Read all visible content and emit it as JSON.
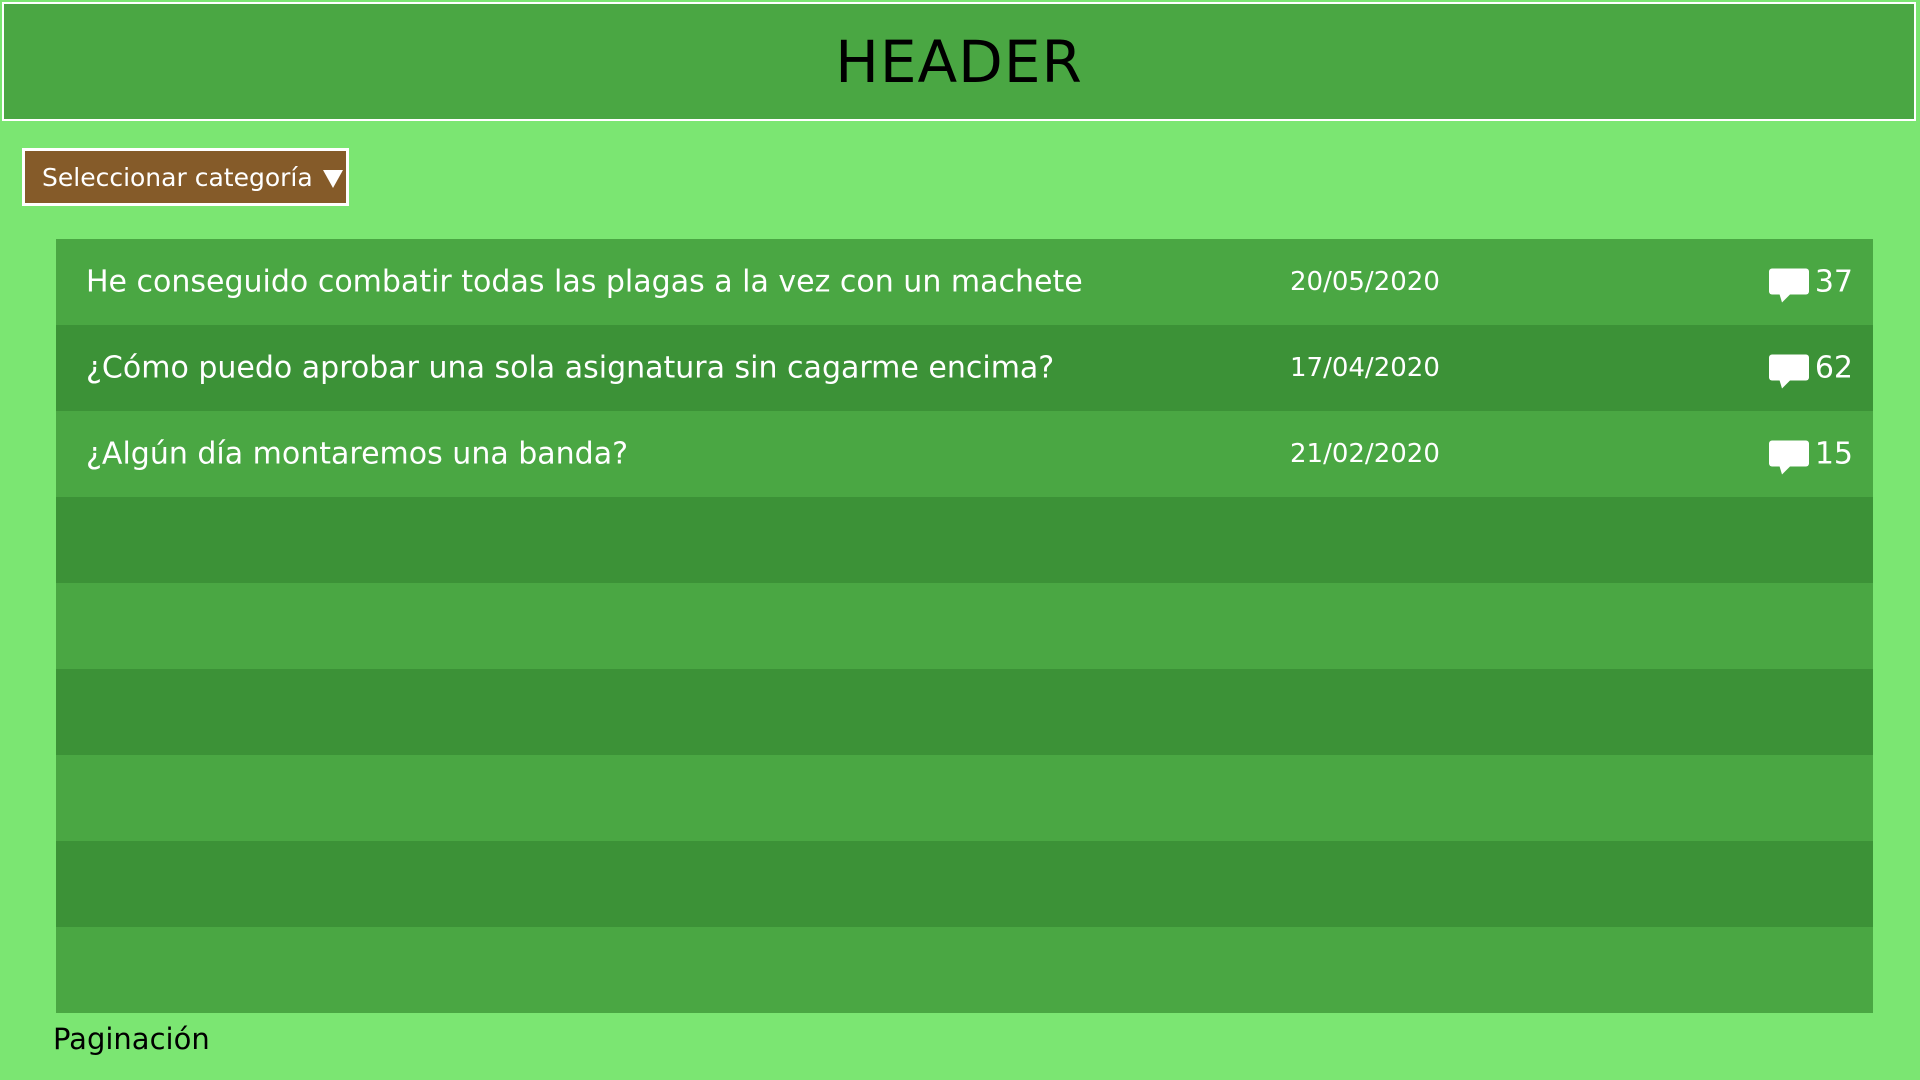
{
  "header": {
    "title": "HEADER"
  },
  "category_select": {
    "label": "Seleccionar categoría",
    "icon": "triangle-down-icon"
  },
  "topics": [
    {
      "title": "He conseguido combatir todas las plagas a la vez con un machete",
      "date": "20/05/2020",
      "comments": "37"
    },
    {
      "title": "¿Cómo puedo aprobar una sola asignatura sin cagarme encima?",
      "date": "17/04/2020",
      "comments": "62"
    },
    {
      "title": "¿Algún día montaremos una banda?",
      "date": "21/02/2020",
      "comments": "15"
    }
  ],
  "empty_rows": 6,
  "pagination": {
    "label": "Paginación"
  },
  "colors": {
    "background": "#7be672",
    "header_bg": "#4aa743",
    "row_light": "#4aa743",
    "row_dark": "#3c9237",
    "select_bg": "#855b29",
    "text_light": "#ffffff",
    "text_dark": "#000000"
  }
}
